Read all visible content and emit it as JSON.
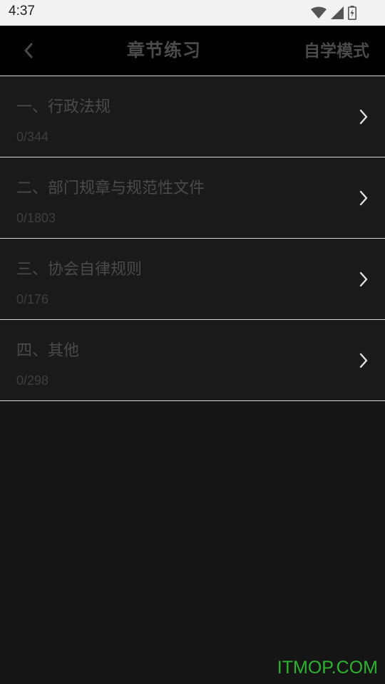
{
  "status_bar": {
    "time": "4:37",
    "icons": [
      "wifi-icon",
      "cell-signal-icon",
      "battery-charging-icon"
    ]
  },
  "header": {
    "back_icon": "chevron-left-icon",
    "title": "章节练习",
    "mode_button": "自学模式"
  },
  "chapters": [
    {
      "title": "一、行政法规",
      "progress": "0/344"
    },
    {
      "title": "二、部门规章与规范性文件",
      "progress": "0/1803"
    },
    {
      "title": "三、协会自律规则",
      "progress": "0/176"
    },
    {
      "title": "四、其他",
      "progress": "0/298"
    }
  ],
  "watermark": "ITMOP.COM",
  "colors": {
    "background": "#151515",
    "nav_background": "#000000",
    "status_bar": "#f2f2f2",
    "muted_text": "#4a4a4a",
    "watermark": "#2bb52f"
  }
}
